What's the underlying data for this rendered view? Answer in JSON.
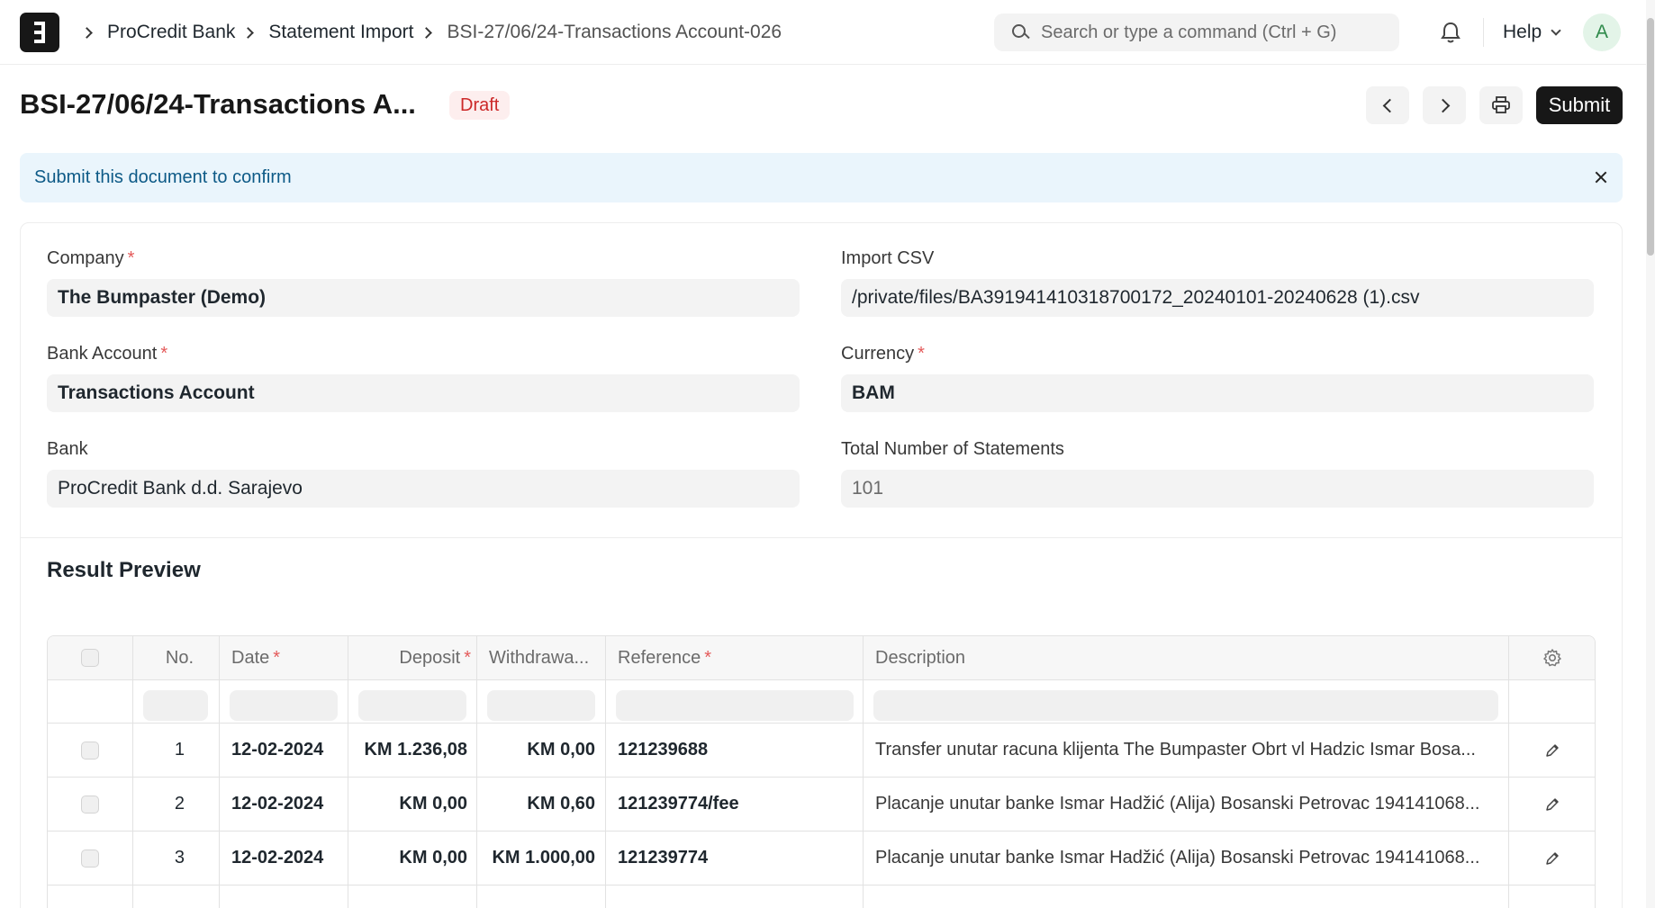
{
  "breadcrumbs": [
    "ProCredit Bank",
    "Statement Import",
    "BSI-27/06/24-Transactions Account-026"
  ],
  "search": {
    "placeholder": "Search or type a command (Ctrl + G)"
  },
  "help_label": "Help",
  "avatar_initial": "A",
  "page": {
    "title": "BSI-27/06/24-Transactions A...",
    "status": "Draft",
    "submit_label": "Submit"
  },
  "alert": {
    "text": "Submit this document to confirm"
  },
  "form": {
    "company": {
      "label": "Company",
      "value": "The Bumpaster (Demo)"
    },
    "import_csv": {
      "label": "Import CSV",
      "value": "/private/files/BA391941410318700172_20240101-20240628 (1).csv"
    },
    "bank_account": {
      "label": "Bank Account",
      "value": "Transactions Account"
    },
    "currency": {
      "label": "Currency",
      "value": "BAM"
    },
    "bank": {
      "label": "Bank",
      "value": "ProCredit Bank d.d. Sarajevo"
    },
    "total_statements": {
      "label": "Total Number of Statements",
      "value": "101"
    }
  },
  "required_mark": "*",
  "result_preview": {
    "title": "Result Preview",
    "columns": {
      "no": "No.",
      "date": "Date",
      "deposit": "Deposit",
      "withdrawal": "Withdrawa...",
      "reference": "Reference",
      "description": "Description"
    },
    "rows": [
      {
        "no": "1",
        "date": "12-02-2024",
        "deposit": "KM 1.236,08",
        "withdrawal": "KM 0,00",
        "reference": "121239688",
        "description": "Transfer unutar racuna klijenta The Bumpaster Obrt vl Hadzic Ismar Bosa..."
      },
      {
        "no": "2",
        "date": "12-02-2024",
        "deposit": "KM 0,00",
        "withdrawal": "KM 0,60",
        "reference": "121239774/fee",
        "description": "Placanje unutar banke Ismar Hadžić (Alija) Bosanski Petrovac 194141068..."
      },
      {
        "no": "3",
        "date": "12-02-2024",
        "deposit": "KM 0,00",
        "withdrawal": "KM 1.000,00",
        "reference": "121239774",
        "description": "Placanje unutar banke Ismar Hadžić (Alija) Bosanski Petrovac 194141068..."
      }
    ]
  }
}
